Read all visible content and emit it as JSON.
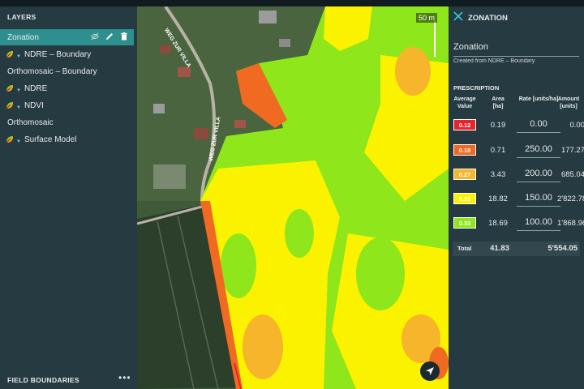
{
  "left_panel": {
    "layers_header": "LAYERS",
    "layers": [
      {
        "label": "Zonation",
        "active": true,
        "icon": "none"
      },
      {
        "label": "NDRE – Boundary",
        "icon": "ndvi-leaf-icon"
      },
      {
        "label": "Orthomosaic – Boundary",
        "icon": "none"
      },
      {
        "label": "NDRE",
        "icon": "ndvi-leaf-icon"
      },
      {
        "label": "NDVI",
        "icon": "ndvi-leaf-icon"
      },
      {
        "label": "Orthomosaic",
        "icon": "none"
      },
      {
        "label": "Surface Model",
        "icon": "ndvi-leaf-icon"
      }
    ],
    "field_boundaries_header": "FIELD BOUNDARIES",
    "field_boundaries_menu": "•••"
  },
  "map": {
    "scale_label": "50 m",
    "street_labels": [
      "WEG ZUR VILLA",
      "WEG ZUR VILLA"
    ]
  },
  "right_panel": {
    "title": "ZONATION",
    "zonation_name": "Zonation",
    "subtitle": "Created from NDRE – Boundary",
    "prescription_header": "PRESCRIPTION",
    "columns": {
      "avg_value": "Average Value",
      "area": "Area [ha]",
      "rate": "Rate [units/ha]",
      "amount": "Amount [units]"
    },
    "rows": [
      {
        "avg": "0.12",
        "area": "0.19",
        "rate": "0.00",
        "amount": "0.00",
        "color": "#e8242a",
        "text_color": "#ffffff"
      },
      {
        "avg": "0.18",
        "area": "0.71",
        "rate": "250.00",
        "amount": "177.27",
        "color": "#f06a21",
        "text_color": "#ffffff"
      },
      {
        "avg": "0.27",
        "area": "3.43",
        "rate": "200.00",
        "amount": "685.04",
        "color": "#f6b52a",
        "text_color": "#ffffff"
      },
      {
        "avg": "0.31",
        "area": "18.82",
        "rate": "150.00",
        "amount": "2'822.78",
        "color": "#fbf200",
        "text_color": "#ffffff"
      },
      {
        "avg": "0.33",
        "area": "18.69",
        "rate": "100.00",
        "amount": "1'868.96",
        "color": "#8fe61a",
        "text_color": "#ffffff"
      }
    ],
    "total": {
      "label": "Total",
      "area": "41.83",
      "amount": "5'554.05"
    }
  },
  "colors": {
    "panel_bg": "#263a41",
    "active_layer": "#2f8f8f",
    "accent_cyan": "#3fc6d6"
  }
}
